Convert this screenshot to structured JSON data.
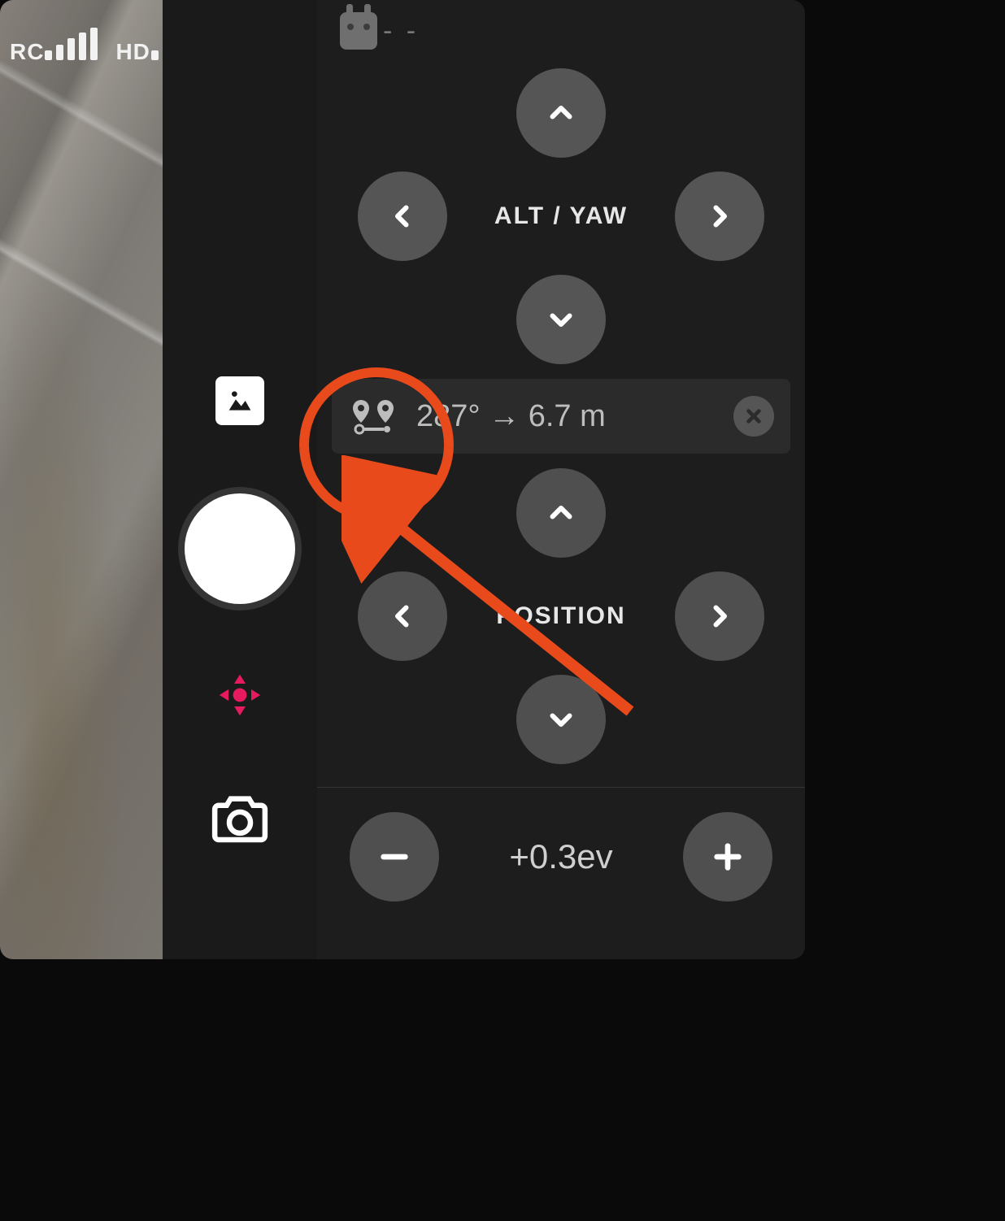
{
  "status": {
    "rc_label": "RC",
    "hd_label": "HD",
    "control_mode": "- -"
  },
  "controls": {
    "alt_yaw_label": "ALT / YAW",
    "position_label": "POSITION"
  },
  "waypoint": {
    "heading_deg": "287°",
    "arrow": "→",
    "distance": "6.7 m"
  },
  "exposure": {
    "value": "+0.3ev"
  },
  "icons": {
    "gallery": "gallery-icon",
    "shutter": "shutter-button",
    "recenter": "recenter-icon",
    "camera": "camera-icon",
    "remote": "remote-controller-icon",
    "waypoint": "waypoint-pair-icon"
  },
  "colors": {
    "annotation": "#e84a1c",
    "accent": "#e51a5f"
  }
}
